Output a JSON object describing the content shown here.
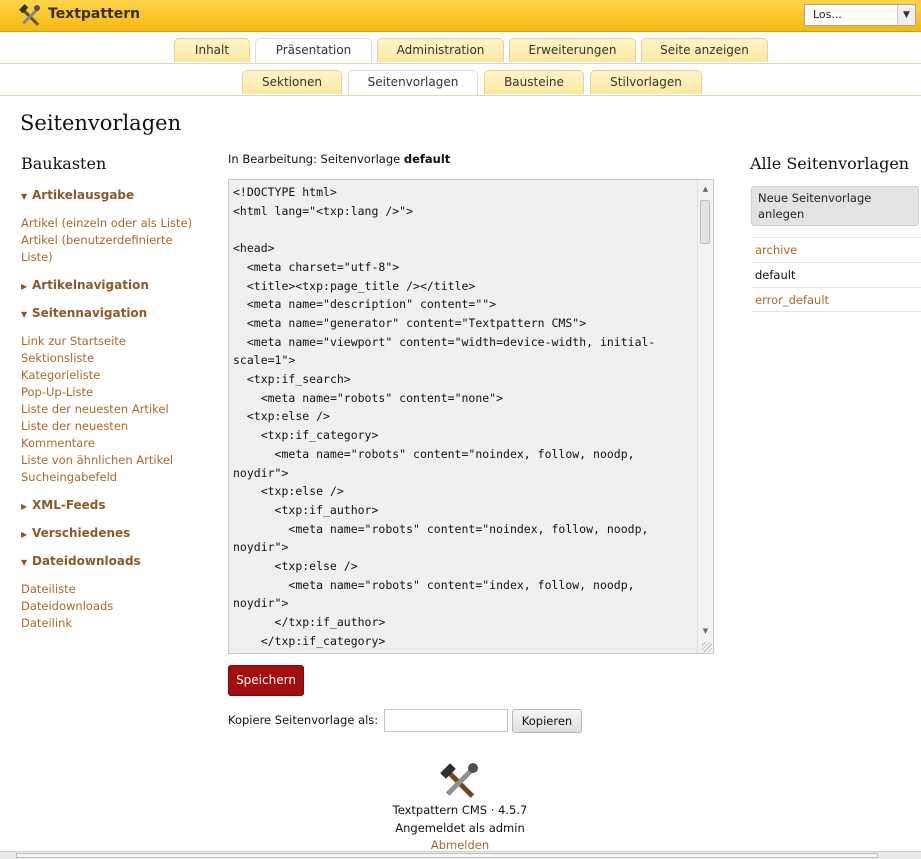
{
  "header": {
    "app_title": "Textpattern",
    "site_select_value": "Los..."
  },
  "primary_tabs": [
    {
      "label": "Inhalt"
    },
    {
      "label": "Präsentation",
      "active": true
    },
    {
      "label": "Administration"
    },
    {
      "label": "Erweiterungen"
    },
    {
      "label": "Seite anzeigen"
    }
  ],
  "secondary_tabs": [
    {
      "label": "Sektionen"
    },
    {
      "label": "Seitenvorlagen",
      "active": true
    },
    {
      "label": "Bausteine"
    },
    {
      "label": "Stilvorlagen"
    }
  ],
  "page_title": "Seitenvorlagen",
  "sidebar": {
    "heading": "Baukasten",
    "groups": [
      {
        "label": "Artikelausgabe",
        "expanded": true,
        "items": [
          "Artikel (einzeln oder als Liste)",
          "Artikel (benutzerdefinierte Liste)"
        ]
      },
      {
        "label": "Artikelnavigation",
        "expanded": false,
        "items": []
      },
      {
        "label": "Seitennavigation",
        "expanded": true,
        "items": [
          "Link zur Startseite",
          "Sektionsliste",
          "Kategorieliste",
          "Pop-Up-Liste",
          "Liste der neuesten Artikel",
          "Liste der neuesten Kommentare",
          "Liste von ähnlichen Artikel",
          "Sucheingabefeld"
        ]
      },
      {
        "label": "XML-Feeds",
        "expanded": false,
        "items": []
      },
      {
        "label": "Verschiedenes",
        "expanded": false,
        "items": []
      },
      {
        "label": "Dateidownloads",
        "expanded": true,
        "items": [
          "Dateiliste",
          "Dateidownloads",
          "Dateilink"
        ]
      }
    ]
  },
  "editor": {
    "editing_prefix": "In Bearbeitung: Seitenvorlage",
    "editing_name": "default",
    "code": "<!DOCTYPE html>\n<html lang=\"<txp:lang />\">\n\n<head>\n  <meta charset=\"utf-8\">\n  <title><txp:page_title /></title>\n  <meta name=\"description\" content=\"\">\n  <meta name=\"generator\" content=\"Textpattern CMS\">\n  <meta name=\"viewport\" content=\"width=device-width, initial-scale=1\">\n  <txp:if_search>\n    <meta name=\"robots\" content=\"none\">\n  <txp:else />\n    <txp:if_category>\n      <meta name=\"robots\" content=\"noindex, follow, noodp, noydir\">\n    <txp:else />\n      <txp:if_author>\n        <meta name=\"robots\" content=\"noindex, follow, noodp, noydir\">\n      <txp:else />\n        <meta name=\"robots\" content=\"index, follow, noodp, noydir\">\n      </txp:if_author>\n    </txp:if_category>",
    "save_label": "Speichern",
    "copy_label": "Kopiere Seitenvorlage als:",
    "copy_input_value": "",
    "copy_button": "Kopieren"
  },
  "pages_panel": {
    "heading": "Alle Seitenvorlagen",
    "new_button": "Neue Seitenvorlage anlegen",
    "pages": [
      {
        "name": "archive"
      },
      {
        "name": "default",
        "current": true
      },
      {
        "name": "error_default"
      }
    ]
  },
  "footer": {
    "version": "Textpattern CMS · 4.5.7",
    "logged_in": "Angemeldet als admin",
    "logout": "Abmelden"
  },
  "icons": {
    "logo": "hammer-wrench-icon",
    "dropdown": "chevron-down-icon"
  },
  "colors": {
    "header_bg": "#f6b910",
    "link": "#a66a2e",
    "save_button": "#a40d0d"
  }
}
